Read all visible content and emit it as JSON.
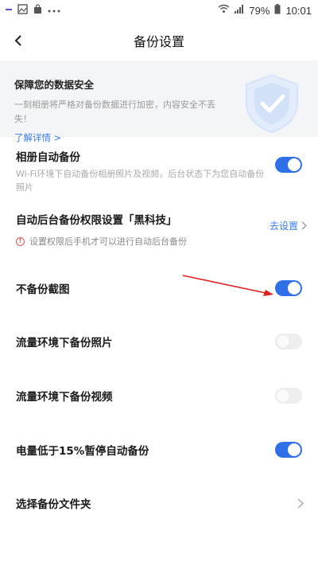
{
  "status_bar": {
    "battery_pct": "79%",
    "time": "10:01"
  },
  "nav": {
    "title": "备份设置"
  },
  "banner": {
    "title": "保障您的数据安全",
    "description": "一刻相册将严格对备份数据进行加密，内容安全不丢失！",
    "link": "了解详情 >"
  },
  "settings": {
    "auto_backup": {
      "title": "相册自动备份",
      "subtitle": "Wi-Fi环境下自动备份相册照片及视频，后台状态下为您自动备份照片",
      "enabled": true
    },
    "bg_permission": {
      "title": "自动后台备份权限设置「黑科技」",
      "warning": "设置权限后手机才可以进行自动后台备份",
      "action": "去设置"
    },
    "no_screenshot": {
      "title": "不备份截图",
      "enabled": true
    },
    "cellular_photos": {
      "title": "流量环境下备份照片",
      "enabled": false
    },
    "cellular_videos": {
      "title": "流量环境下备份视频",
      "enabled": false
    },
    "low_battery": {
      "title": "电量低于15%暂停自动备份",
      "enabled": true
    },
    "backup_folder": {
      "title": "选择备份文件夹"
    }
  },
  "colors": {
    "accent": "#2f6fe8",
    "link": "#3a7bf0",
    "annotation_arrow": "#e02020"
  }
}
